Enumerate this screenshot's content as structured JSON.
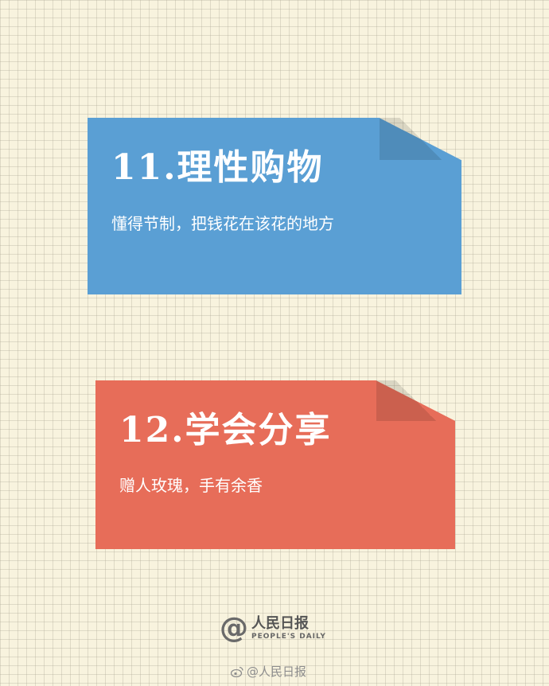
{
  "colors": {
    "background": "#f8f3de",
    "card1": "#5a9fd4",
    "card2": "#e76d59"
  },
  "cards": [
    {
      "title": "11.理性购物",
      "subtitle": "懂得节制，把钱花在该花的地方"
    },
    {
      "title": "12.学会分享",
      "subtitle": "赠人玫瑰，手有余香"
    }
  ],
  "logo": {
    "symbol": "@",
    "name_cn": "人民日报",
    "name_en": "PEOPLE'S DAILY"
  },
  "watermark": {
    "icon": "weibo-icon",
    "text": "@人民日报"
  }
}
